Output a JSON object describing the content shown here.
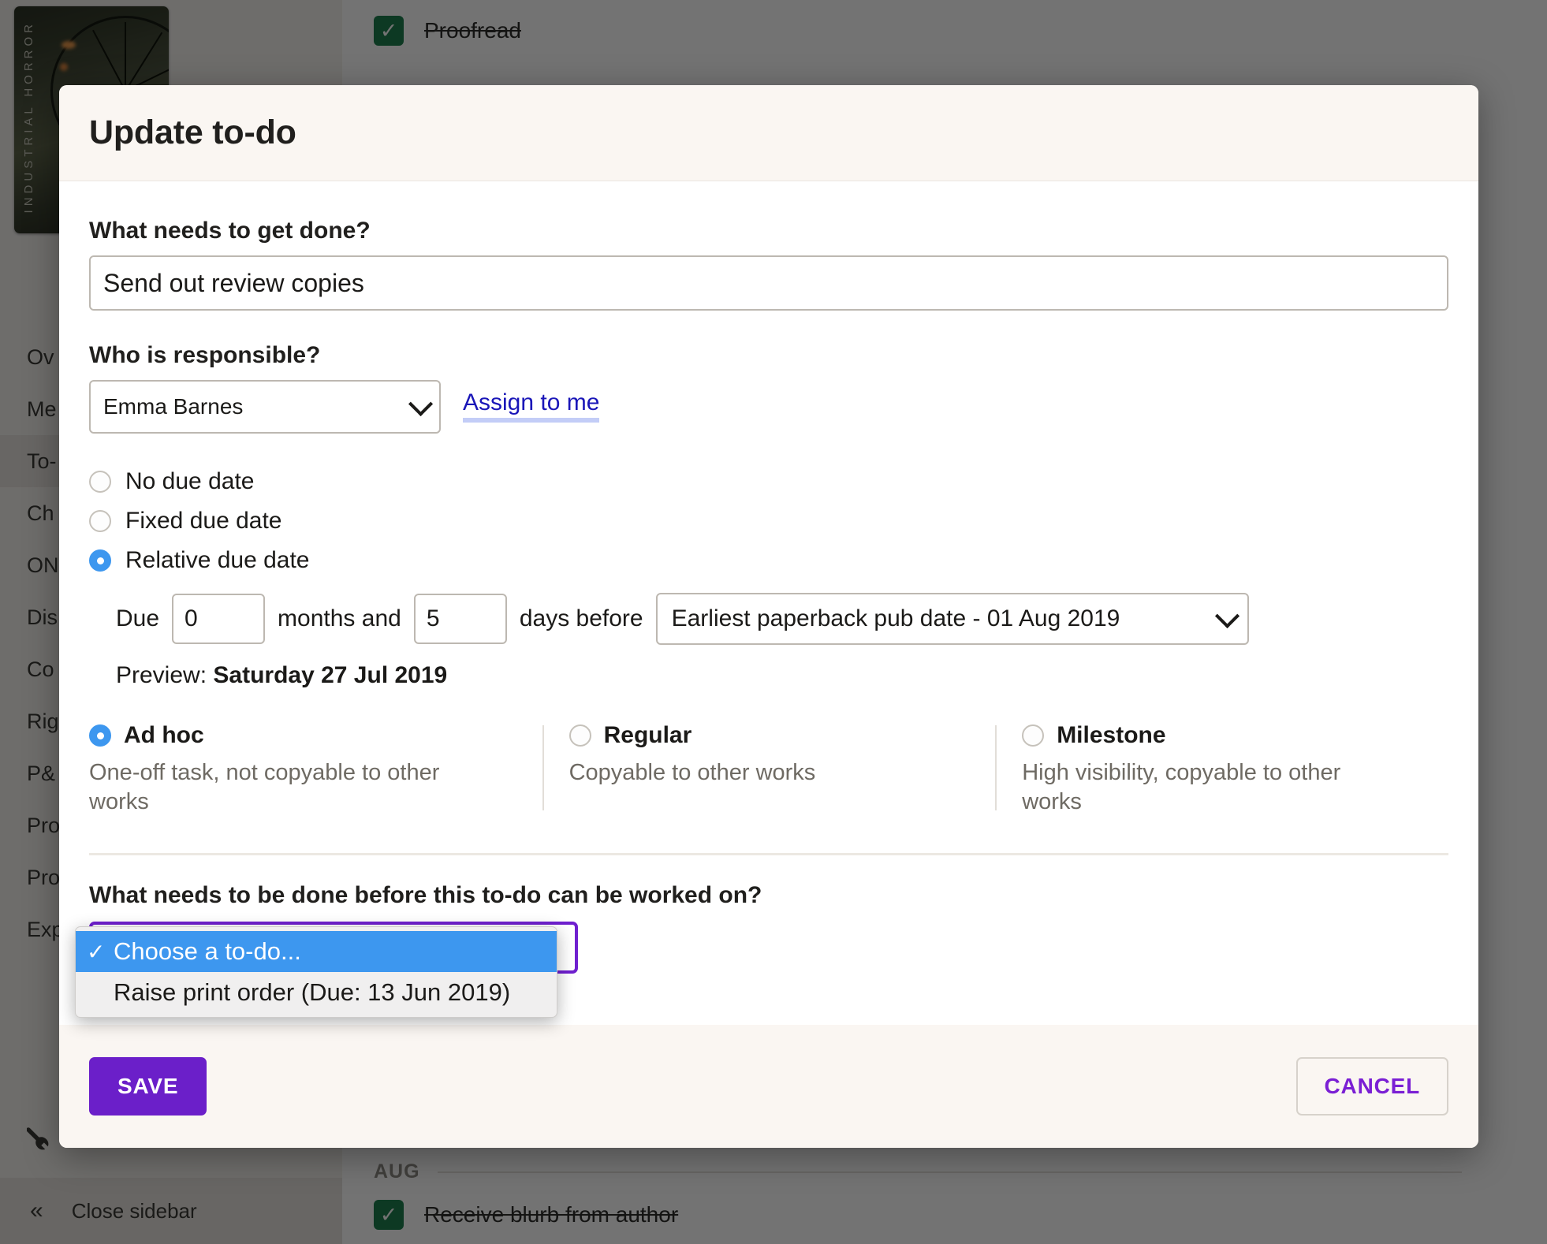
{
  "background": {
    "cover": {
      "spine_text": "INDUSTRIAL HORROR"
    },
    "sidebar": {
      "items": [
        {
          "label": "Ov",
          "active": false
        },
        {
          "label": "Me",
          "active": false
        },
        {
          "label": "To-",
          "active": true
        },
        {
          "label": "Ch",
          "active": false
        },
        {
          "label": "ON",
          "active": false
        },
        {
          "label": "Dis",
          "active": false
        },
        {
          "label": "Co",
          "active": false
        },
        {
          "label": "Rig",
          "active": false
        },
        {
          "label": "P&",
          "active": false
        },
        {
          "label": "Pro",
          "active": false
        },
        {
          "label": "Pro",
          "active": false
        },
        {
          "label": "Exp",
          "active": false
        }
      ],
      "settings_icon": "wrench-icon",
      "close_label": "Close sidebar",
      "close_chevron": "«"
    },
    "tasks": [
      {
        "label": "Proofread",
        "done": true
      },
      {
        "label": "Receive blurb from author",
        "done": true
      }
    ],
    "month_divider": "AUG"
  },
  "modal": {
    "title": "Update to-do",
    "name_field": {
      "label": "What needs to get done?",
      "value": "Send out review copies",
      "placeholder": ""
    },
    "responsible": {
      "label": "Who is responsible?",
      "selected": "Emma Barnes",
      "assign_link": "Assign to me"
    },
    "due_mode": {
      "options": [
        {
          "label": "No due date",
          "selected": false
        },
        {
          "label": "Fixed due date",
          "selected": false
        },
        {
          "label": "Relative due date",
          "selected": true
        }
      ]
    },
    "relative_due": {
      "prefix": "Due",
      "months": "0",
      "mid": "months and",
      "days": "5",
      "suffix": "days before",
      "anchor": "Earliest paperback pub date - 01 Aug 2019",
      "preview_label": "Preview:",
      "preview_value": "Saturday 27 Jul 2019"
    },
    "task_types": [
      {
        "name": "Ad hoc",
        "desc": "One-off task, not copyable to other works",
        "selected": true
      },
      {
        "name": "Regular",
        "desc": "Copyable to other works",
        "selected": false
      },
      {
        "name": "Milestone",
        "desc": "High visibility, copyable to other works",
        "selected": false
      }
    ],
    "dependency": {
      "label": "What needs to be done before this to-do can be worked on?",
      "options": [
        {
          "label": "Choose a to-do...",
          "selected": true
        },
        {
          "label": "Raise print order (Due: 13 Jun 2019)",
          "selected": false
        }
      ],
      "tick": "✓"
    },
    "footer": {
      "save_label": "SAVE",
      "cancel_label": "CANCEL"
    }
  },
  "colors": {
    "accent_purple": "#6b1fc9",
    "radio_blue": "#3d97ef",
    "link_blue": "#1a16b8",
    "check_green": "#1e7f4f",
    "highlight_blue": "#3d97ef"
  }
}
